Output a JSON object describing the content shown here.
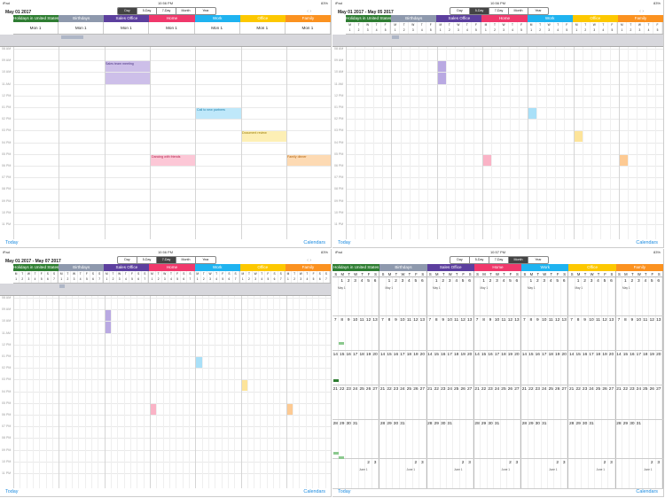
{
  "calendars": [
    {
      "name": "Holidays in United States",
      "color": "#2e7d32"
    },
    {
      "name": "Birthdays",
      "color": "#8e99ad"
    },
    {
      "name": "Sales Office",
      "color": "#5c3f9e"
    },
    {
      "name": "Home",
      "color": "#f0386b"
    },
    {
      "name": "Work",
      "color": "#1fb3f0"
    },
    {
      "name": "Office",
      "color": "#fdc800"
    },
    {
      "name": "Family",
      "color": "#fb9220"
    }
  ],
  "views": [
    "Day",
    "5-Day",
    "7-Day",
    "Month",
    "Year"
  ],
  "hours": [
    "08 AM",
    "09 AM",
    "10 AM",
    "11 AM",
    "12 PM",
    "01 PM",
    "02 PM",
    "03 PM",
    "04 PM",
    "05 PM",
    "06 PM",
    "07 PM",
    "08 PM",
    "09 PM",
    "10 PM",
    "11 PM"
  ],
  "bottom": {
    "today": "Today",
    "calendars": "Calendars"
  },
  "nav_arrows": "‹ ›",
  "quadrants": [
    {
      "status": {
        "carrier": "iPad",
        "time": "10:56 PM",
        "battery": "83%"
      },
      "date_label": "May 01 2017",
      "active_view": "Day",
      "day_label": "Mon  1",
      "events": [
        {
          "text": "Sales team meeting",
          "cal": 2
        },
        {
          "text": "Call to new partners",
          "cal": 4
        },
        {
          "text": "Document review",
          "cal": 5
        },
        {
          "text": "Dancing with friends",
          "cal": 3
        },
        {
          "text": "Family dinner",
          "cal": 6
        }
      ]
    },
    {
      "status": {
        "carrier": "iPad",
        "time": "10:56 PM",
        "battery": "83%"
      },
      "date_label": "May 01 2017 - May 05 2017",
      "active_view": "5-Day",
      "weekdays": [
        "M",
        "T",
        "W",
        "T",
        "F"
      ],
      "dates": [
        "1",
        "2",
        "3",
        "4",
        "5"
      ]
    },
    {
      "status": {
        "carrier": "iPad",
        "time": "10:56 PM",
        "battery": "83%"
      },
      "date_label": "May 01 2017 - May 07 2017",
      "active_view": "7-Day",
      "weekdays": [
        "M",
        "T",
        "W",
        "T",
        "F",
        "S",
        "S"
      ],
      "dates": [
        "1",
        "2",
        "3",
        "4",
        "5",
        "6",
        "7"
      ]
    },
    {
      "status": {
        "carrier": "iPad",
        "time": "10:57 PM",
        "battery": "83%"
      },
      "date_label": "",
      "active_view": "Month",
      "weekdays": [
        "S",
        "M",
        "T",
        "W",
        "T",
        "F",
        "S"
      ],
      "weeks": [
        [
          "",
          "1",
          "2",
          "3",
          "4",
          "5",
          "6"
        ],
        [
          "7",
          "8",
          "9",
          "10",
          "11",
          "12",
          "13"
        ],
        [
          "14",
          "15",
          "16",
          "17",
          "18",
          "19",
          "20"
        ],
        [
          "21",
          "22",
          "23",
          "24",
          "25",
          "26",
          "27"
        ],
        [
          "28",
          "29",
          "30",
          "31",
          "",
          "",
          ""
        ],
        [
          "",
          "",
          "",
          "",
          "",
          "2",
          "3"
        ]
      ],
      "month_marks": {
        "may": "May 1",
        "june": "June 1"
      }
    }
  ]
}
